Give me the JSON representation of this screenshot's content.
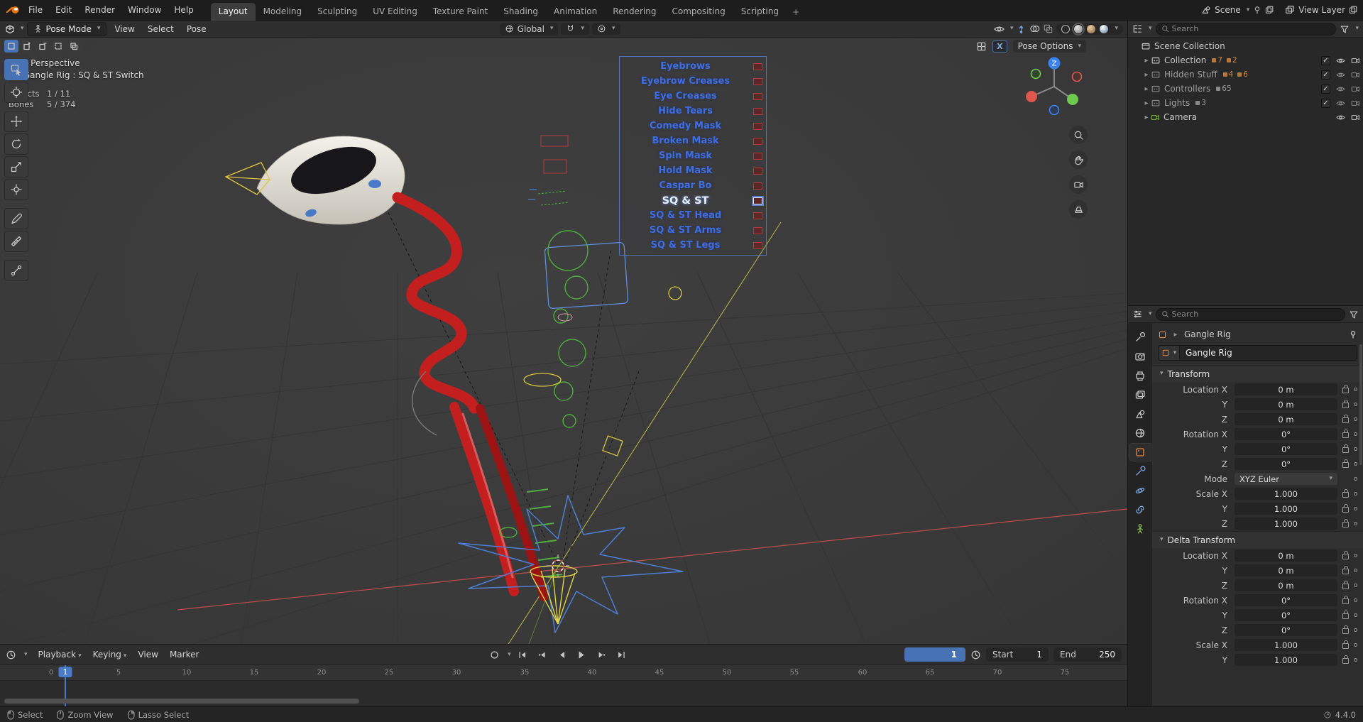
{
  "icons": {
    "chevron_down": "▾",
    "chevron_right": "▸",
    "check": "✓"
  },
  "topbar": {
    "menus": [
      "File",
      "Edit",
      "Render",
      "Window",
      "Help"
    ],
    "workspaces": [
      "Layout",
      "Modeling",
      "Sculpting",
      "UV Editing",
      "Texture Paint",
      "Shading",
      "Animation",
      "Rendering",
      "Compositing",
      "Scripting"
    ],
    "add_tab": "+",
    "scene_name": "Scene",
    "view_layer_name": "View Layer"
  },
  "vp_header": {
    "mode": "Pose Mode",
    "menus": [
      "View",
      "Select",
      "Pose"
    ],
    "orientation": "Global",
    "mirror_x": "X",
    "pose_options": "Pose Options"
  },
  "viewport": {
    "perspective": "User Perspective",
    "active_item": "(1) Gangle Rig : SQ & ST Switch",
    "objects_label": "Objects",
    "objects_value": "1 / 11",
    "bones_label": "Bones",
    "bones_value": "5 / 374",
    "gizmo_z": "Z",
    "bone_buttons": [
      "Eyebrows",
      "Eyebrow Creases",
      "Eye Creases",
      "Hide Tears",
      "Comedy Mask",
      "Broken Mask",
      "Spin Mask",
      "Hold Mask",
      "Caspar Bo",
      "SQ & ST",
      "SQ & ST Head",
      "SQ & ST Arms",
      "SQ & ST Legs"
    ]
  },
  "outliner": {
    "search_placeholder": "Search",
    "root_label": "Scene Collection",
    "items": [
      {
        "label": "Collection",
        "badge1": "7",
        "badge2": "2"
      },
      {
        "label": "Hidden Stuff",
        "badge1": "4",
        "badge2": "6"
      },
      {
        "label": "Controllers",
        "badge1": "65"
      },
      {
        "label": "Lights",
        "badge1": "3"
      },
      {
        "label": "Camera"
      }
    ]
  },
  "properties": {
    "search_placeholder": "Search",
    "breadcrumb": "Gangle Rig",
    "name_value": "Gangle Rig",
    "transform": {
      "title": "Transform",
      "rows": [
        {
          "label": "Location X",
          "value": "0 m"
        },
        {
          "label": "Y",
          "value": "0 m"
        },
        {
          "label": "Z",
          "value": "0 m"
        },
        {
          "label": "Rotation X",
          "value": "0°"
        },
        {
          "label": "Y",
          "value": "0°"
        },
        {
          "label": "Z",
          "value": "0°"
        },
        {
          "label": "Mode",
          "value": "XYZ Euler"
        },
        {
          "label": "Scale X",
          "value": "1.000"
        },
        {
          "label": "Y",
          "value": "1.000"
        },
        {
          "label": "Z",
          "value": "1.000"
        }
      ]
    },
    "delta": {
      "title": "Delta Transform",
      "rows": [
        {
          "label": "Location X",
          "value": "0 m"
        },
        {
          "label": "Y",
          "value": "0 m"
        },
        {
          "label": "Z",
          "value": "0 m"
        },
        {
          "label": "Rotation X",
          "value": "0°"
        },
        {
          "label": "Y",
          "value": "0°"
        },
        {
          "label": "Z",
          "value": "0°"
        },
        {
          "label": "Scale X",
          "value": "1.000"
        },
        {
          "label": "Y",
          "value": "1.000"
        }
      ]
    }
  },
  "timeline": {
    "menus": [
      "Playback",
      "Keying",
      "View",
      "Marker"
    ],
    "current_frame": "1",
    "start_label": "Start",
    "start_value": "1",
    "end_label": "End",
    "end_value": "250",
    "ticks": [
      "0",
      "5",
      "10",
      "15",
      "20",
      "25",
      "30",
      "35",
      "40",
      "45",
      "50",
      "55",
      "60",
      "65",
      "70",
      "75"
    ]
  },
  "statusbar": {
    "items": [
      "Select",
      "Zoom View",
      "Lasso Select"
    ],
    "version": "4.4.0"
  }
}
